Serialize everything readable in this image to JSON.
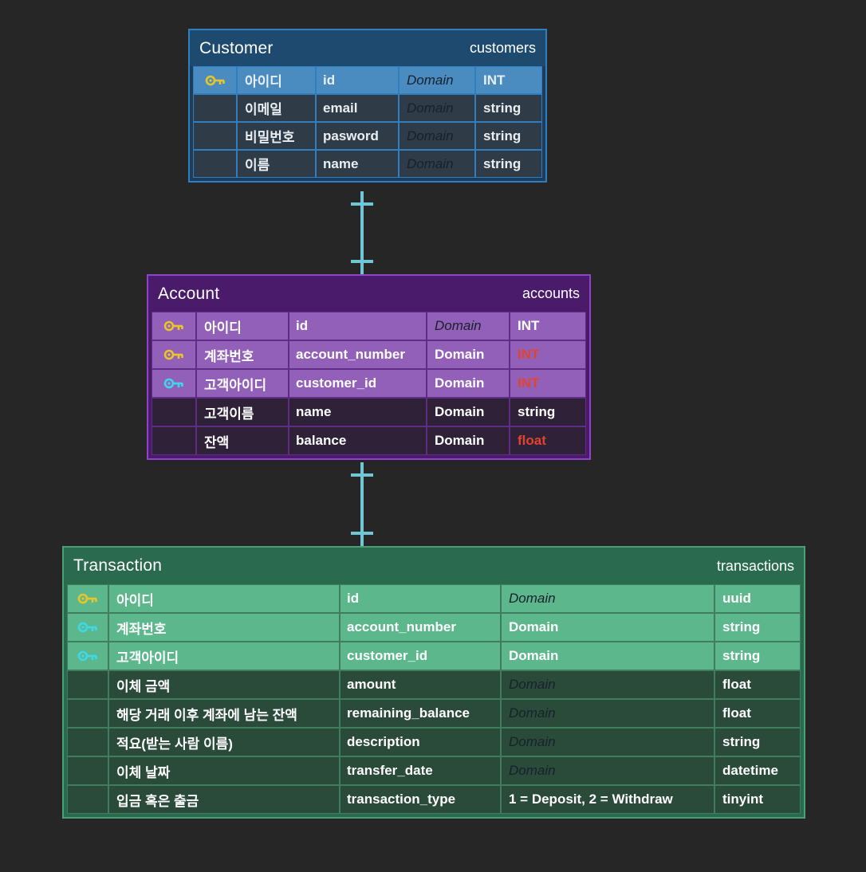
{
  "diagram": {
    "type": "entity-relationship-diagram",
    "background_color": "#262626",
    "connector_color": "#6fc6d4"
  },
  "entities": [
    {
      "id": "customer",
      "title": "Customer",
      "physical_name": "customers",
      "accent_color": "#2f7fc0",
      "header_color": "#1d4a6e",
      "columns": [
        "key",
        "logical",
        "physical",
        "domain",
        "type"
      ],
      "rows": [
        {
          "key": "primary-key",
          "key_icon": "key-icon-yellow",
          "logical": "아이디",
          "physical": "id",
          "domain": "Domain",
          "domain_is_placeholder": true,
          "type": "INT",
          "type_alt": false,
          "highlighted": true
        },
        {
          "key": "none",
          "key_icon": "",
          "logical": "이메일",
          "physical": "email",
          "domain": "Domain",
          "domain_is_placeholder": true,
          "type": "string",
          "type_alt": false,
          "highlighted": false
        },
        {
          "key": "none",
          "key_icon": "",
          "logical": "비밀번호",
          "physical": "pasword",
          "domain": "Domain",
          "domain_is_placeholder": true,
          "type": "string",
          "type_alt": false,
          "highlighted": false
        },
        {
          "key": "none",
          "key_icon": "",
          "logical": "이름",
          "physical": "name",
          "domain": "Domain",
          "domain_is_placeholder": true,
          "type": "string",
          "type_alt": false,
          "highlighted": false
        }
      ]
    },
    {
      "id": "account",
      "title": "Account",
      "physical_name": "accounts",
      "accent_color": "#8e44c8",
      "header_color": "#4a1a6b",
      "columns": [
        "key",
        "logical",
        "physical",
        "domain",
        "type"
      ],
      "rows": [
        {
          "key": "primary-key",
          "key_icon": "key-icon-yellow",
          "logical": "아이디",
          "physical": "id",
          "domain": "Domain",
          "domain_is_placeholder": true,
          "type": "INT",
          "type_alt": false,
          "highlighted": true
        },
        {
          "key": "primary-key",
          "key_icon": "key-icon-yellow",
          "logical": "계좌번호",
          "physical": "account_number",
          "domain": "Domain",
          "domain_is_placeholder": false,
          "type": "INT",
          "type_alt": true,
          "highlighted": true
        },
        {
          "key": "foreign-key",
          "key_icon": "key-icon-cyan",
          "logical": "고객아이디",
          "physical": "customer_id",
          "domain": "Domain",
          "domain_is_placeholder": false,
          "type": "INT",
          "type_alt": true,
          "highlighted": true
        },
        {
          "key": "none",
          "key_icon": "",
          "logical": "고객이름",
          "physical": "name",
          "domain": "Domain",
          "domain_is_placeholder": false,
          "type": "string",
          "type_alt": false,
          "highlighted": false
        },
        {
          "key": "none",
          "key_icon": "",
          "logical": "잔액",
          "physical": "balance",
          "domain": "Domain",
          "domain_is_placeholder": false,
          "type": "float",
          "type_alt": true,
          "highlighted": false
        }
      ]
    },
    {
      "id": "transaction",
      "title": "Transaction",
      "physical_name": "transactions",
      "accent_color": "#4e9e74",
      "header_color": "#2a6b4f",
      "columns": [
        "key",
        "logical",
        "physical",
        "domain",
        "type"
      ],
      "rows": [
        {
          "key": "primary-key",
          "key_icon": "key-icon-yellow",
          "logical": "아이디",
          "physical": "id",
          "domain": "Domain",
          "domain_is_placeholder": true,
          "type": "uuid",
          "type_alt": false,
          "highlighted": true
        },
        {
          "key": "foreign-key",
          "key_icon": "key-icon-cyan",
          "logical": "계좌번호",
          "physical": "account_number",
          "domain": "Domain",
          "domain_is_placeholder": false,
          "type": "string",
          "type_alt": false,
          "highlighted": true
        },
        {
          "key": "foreign-key",
          "key_icon": "key-icon-cyan",
          "logical": "고객아이디",
          "physical": "customer_id",
          "domain": "Domain",
          "domain_is_placeholder": false,
          "type": "string",
          "type_alt": false,
          "highlighted": true
        },
        {
          "key": "none",
          "key_icon": "",
          "logical": "이체 금액",
          "physical": "amount",
          "domain": "Domain",
          "domain_is_placeholder": true,
          "type": "float",
          "type_alt": false,
          "highlighted": false
        },
        {
          "key": "none",
          "key_icon": "",
          "logical": "해당 거래 이후 계좌에 남는 잔액",
          "physical": "remaining_balance",
          "domain": "Domain",
          "domain_is_placeholder": true,
          "type": "float",
          "type_alt": false,
          "highlighted": false
        },
        {
          "key": "none",
          "key_icon": "",
          "logical": "적요(받는 사람 이름)",
          "physical": "description",
          "domain": "Domain",
          "domain_is_placeholder": true,
          "type": "string",
          "type_alt": false,
          "highlighted": false
        },
        {
          "key": "none",
          "key_icon": "",
          "logical": "이체 날짜",
          "physical": "transfer_date",
          "domain": "Domain",
          "domain_is_placeholder": true,
          "type": "datetime",
          "type_alt": false,
          "highlighted": false
        },
        {
          "key": "none",
          "key_icon": "",
          "logical": "입금 혹은 출금",
          "physical": "transaction_type",
          "domain": "1 = Deposit, 2 = Withdraw",
          "domain_is_placeholder": false,
          "type": "tinyint",
          "type_alt": false,
          "highlighted": false
        }
      ]
    }
  ],
  "relationships": [
    {
      "id": "customer-account",
      "from": "Customer",
      "to": "Account",
      "notation": "one-to-one"
    },
    {
      "id": "account-transaction",
      "from": "Account",
      "to": "Transaction",
      "notation": "one-to-one"
    }
  ]
}
